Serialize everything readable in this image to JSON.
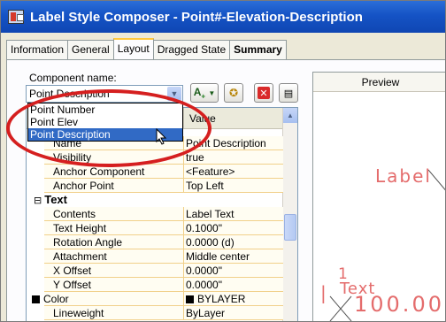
{
  "window": {
    "title": "Label Style Composer - Point#-Elevation-Description"
  },
  "tabs": [
    {
      "label": "Information"
    },
    {
      "label": "General"
    },
    {
      "label": "Layout"
    },
    {
      "label": "Dragged State"
    },
    {
      "label": "Summary"
    }
  ],
  "component": {
    "label": "Component name:",
    "selected": "Point Description",
    "options": [
      "Point Number",
      "Point Elev",
      "Point Description"
    ]
  },
  "grid": {
    "value_header": "Value",
    "rows": [
      {
        "name": "Name",
        "value": "Point Description"
      },
      {
        "name": "Visibility",
        "value": "true"
      },
      {
        "name": "Anchor Component",
        "value": "<Feature>"
      },
      {
        "name": "Anchor Point",
        "value": "Top Left"
      }
    ],
    "text_section": "Text",
    "text_rows": [
      {
        "name": "Contents",
        "value": "Label Text"
      },
      {
        "name": "Text Height",
        "value": "0.1000\""
      },
      {
        "name": "Rotation Angle",
        "value": "0.0000 (d)"
      },
      {
        "name": "Attachment",
        "value": "Middle center"
      },
      {
        "name": "X Offset",
        "value": "0.0000\""
      },
      {
        "name": "Y Offset",
        "value": "0.0000\""
      },
      {
        "name": "Color",
        "value": "BYLAYER"
      },
      {
        "name": "Lineweight",
        "value": "ByLayer"
      }
    ]
  },
  "preview": {
    "title": "Preview",
    "label_text": "Label",
    "num_text": "1",
    "text_text": "Text",
    "elev_text": "100.00"
  },
  "colors": {
    "title_bar": "#1553c5",
    "annotation_red": "#d51f1f",
    "preview_text": "#e46c6c"
  }
}
